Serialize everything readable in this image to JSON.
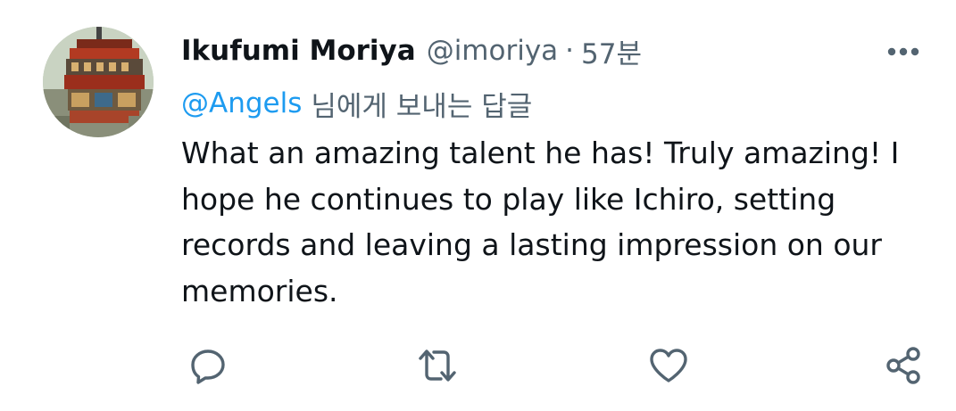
{
  "tweet": {
    "author_name": "Ikufumi Moriya",
    "author_handle": "@imoriya",
    "separator": "·",
    "time": "57분",
    "reply_mention": "@Angels",
    "reply_suffix": "님에게 보내는 답글",
    "text": "What an amazing talent he has! Truly amazing! I hope he continues to play like Ichiro, setting records and leaving a lasting impression on our memories."
  },
  "icons": {
    "more": "more-horizontal-icon",
    "reply": "reply-icon",
    "retweet": "retweet-icon",
    "like": "heart-icon",
    "share": "share-icon"
  },
  "colors": {
    "text": "#0f1419",
    "secondary": "#536471",
    "mention": "#1d9bf0"
  }
}
